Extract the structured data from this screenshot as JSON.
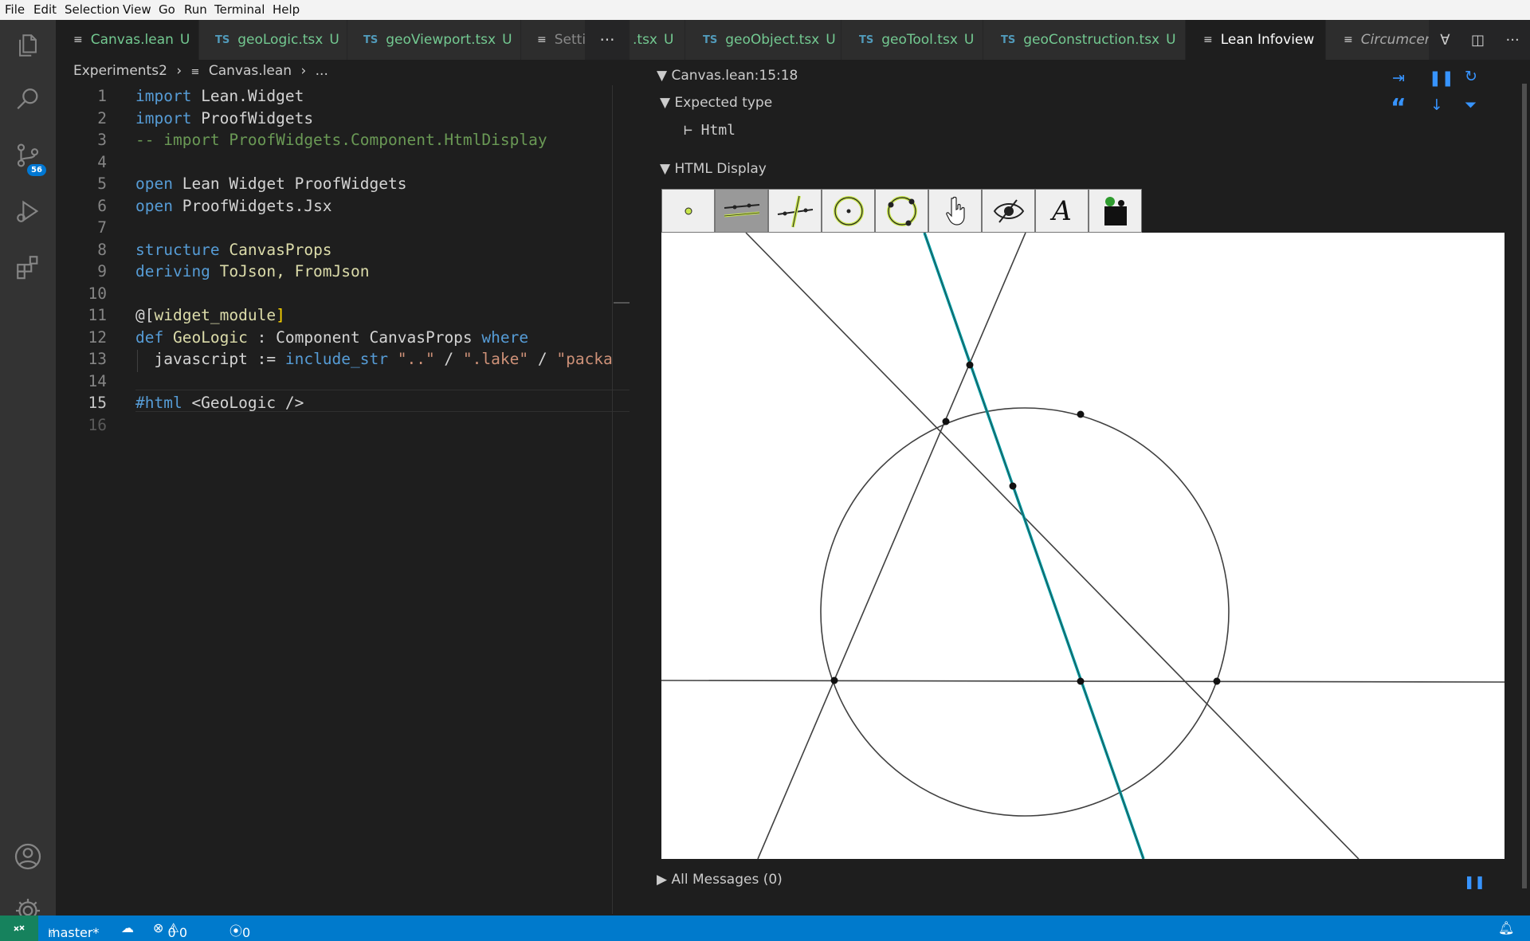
{
  "menu": [
    "File",
    "Edit",
    "Selection",
    "View",
    "Go",
    "Run",
    "Terminal",
    "Help"
  ],
  "activity": {
    "scm_badge": "56"
  },
  "left_tabs": [
    {
      "icon": "≡",
      "name": "Canvas.lean",
      "mod": "U"
    },
    {
      "icon": "TS",
      "name": "geoLogic.tsx",
      "mod": "U"
    },
    {
      "icon": "TS",
      "name": "geoViewport.tsx",
      "mod": "U"
    },
    {
      "icon": "≡",
      "name": "Setti"
    }
  ],
  "right_tabs": [
    {
      "name": ".tsx",
      "mod": "U"
    },
    {
      "icon": "TS",
      "name": "geoObject.tsx",
      "mod": "U"
    },
    {
      "icon": "TS",
      "name": "geoTool.tsx",
      "mod": "U"
    },
    {
      "icon": "TS",
      "name": "geoConstruction.tsx",
      "mod": "U"
    },
    {
      "icon": "≡",
      "name": "Lean Infoview"
    },
    {
      "icon": "≡",
      "name": "Circumcen"
    }
  ],
  "breadcrumb": {
    "folder": "Experiments2",
    "file": "Canvas.lean",
    "rest": "..."
  },
  "code": {
    "numbers": [
      "1",
      "2",
      "3",
      "4",
      "5",
      "6",
      "7",
      "8",
      "9",
      "10",
      "11",
      "12",
      "13",
      "14",
      "15",
      "16"
    ],
    "l1a": "import",
    "l1b": " Lean.Widget",
    "l2a": "import",
    "l2b": " ProofWidgets",
    "l3": "-- import ProofWidgets.Component.HtmlDisplay",
    "l5a": "open",
    "l5b": " Lean Widget ProofWidgets",
    "l6a": "open",
    "l6b": " ProofWidgets.Jsx",
    "l8a": "structure",
    "l8b": " CanvasProps",
    "l9a": "deriving",
    "l9b": " ToJson, FromJson",
    "l11a": "@[",
    "l11b": "widget_module",
    "l11c": "]",
    "l12a": "def",
    "l12b": " GeoLogic",
    "l12c": " : Component CanvasProps ",
    "l12d": "where",
    "l13a": "  javascript := ",
    "l13b": "include_str",
    "l13c": " \"..\"",
    "l13d": " / ",
    "l13e": "\".lake\"",
    "l13f": " / ",
    "l13g": "\"packa",
    "l15a": "#html",
    "l15b": " <GeoLogic />"
  },
  "infoview": {
    "location": "Canvas.lean:15:18",
    "expected_type": "Expected type",
    "type_value": "⊢ Html",
    "html_display": "HTML Display",
    "all_messages": "All Messages (0)"
  },
  "tools": [
    "point-tool",
    "parallel-tool",
    "perpendicular-tool",
    "circle-tool",
    "circumcircle-tool",
    "move-tool",
    "hide-tool",
    "label-tool",
    "puzzle-tool"
  ],
  "status": {
    "branch": "master*",
    "errors": "0",
    "warnings": "0",
    "ports": "0"
  },
  "colors": {
    "accent": "#007acc",
    "teal_line": "#00a0a8",
    "remote": "#16825d"
  }
}
